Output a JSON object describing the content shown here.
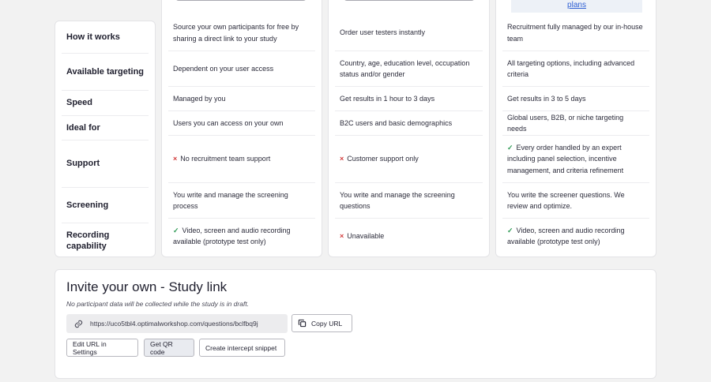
{
  "labels": [
    "How it works",
    "Available targeting",
    "Speed",
    "Ideal for",
    "Support",
    "Screening",
    "Recording capability"
  ],
  "columns": [
    {
      "cells": [
        {
          "text": "Source your own participants for free by sharing a direct link to your study",
          "icon": ""
        },
        {
          "text": "Dependent on your user access",
          "icon": ""
        },
        {
          "text": "Managed by you",
          "icon": ""
        },
        {
          "text": "Users you can access on your own",
          "icon": ""
        },
        {
          "text": "No recruitment team support",
          "icon": "cross"
        },
        {
          "text": "You write and manage the screening process",
          "icon": ""
        },
        {
          "text": "Video, screen and audio recording available (prototype test only)",
          "icon": "check"
        }
      ]
    },
    {
      "cells": [
        {
          "text": "Order user testers instantly",
          "icon": ""
        },
        {
          "text": "Country, age, education level, occupation status and/or gender",
          "icon": ""
        },
        {
          "text": "Get results in 1 hour to 3 days",
          "icon": ""
        },
        {
          "text": "B2C users and basic demographics",
          "icon": ""
        },
        {
          "text": "Customer support only",
          "icon": "cross"
        },
        {
          "text": "You write and manage the screening questions",
          "icon": ""
        },
        {
          "text": "Unavailable",
          "icon": "cross"
        }
      ]
    },
    {
      "plans_link": "plans",
      "cells": [
        {
          "text": "Recruitment fully managed by our in-house team",
          "icon": ""
        },
        {
          "text": "All targeting options, including advanced criteria",
          "icon": ""
        },
        {
          "text": "Get results in 3 to 5 days",
          "icon": ""
        },
        {
          "text": "Global users, B2B, or niche targeting needs",
          "icon": ""
        },
        {
          "text": "Every order handled by an expert including panel selection, incentive management, and criteria refinement",
          "icon": "check"
        },
        {
          "text": "You write the screener questions. We review and optimize.",
          "icon": ""
        },
        {
          "text": "Video, screen and audio recording available (prototype test only)",
          "icon": "check"
        }
      ]
    }
  ],
  "icons": {
    "cross": "×",
    "check": "✓"
  },
  "invite": {
    "title": "Invite your own - Study link",
    "note": "No participant data will be collected while the study is in draft.",
    "url": "https://uco5tbl4.optimalworkshop.com/questions/bclfbq9j",
    "copy_label": "Copy URL",
    "edit_label": "Edit URL in Settings",
    "qr_label": "Get QR code",
    "snippet_label": "Create intercept snippet"
  },
  "colors": {
    "cross": "#d23b3b",
    "check": "#2f9a55",
    "link": "#2f5fd3"
  }
}
